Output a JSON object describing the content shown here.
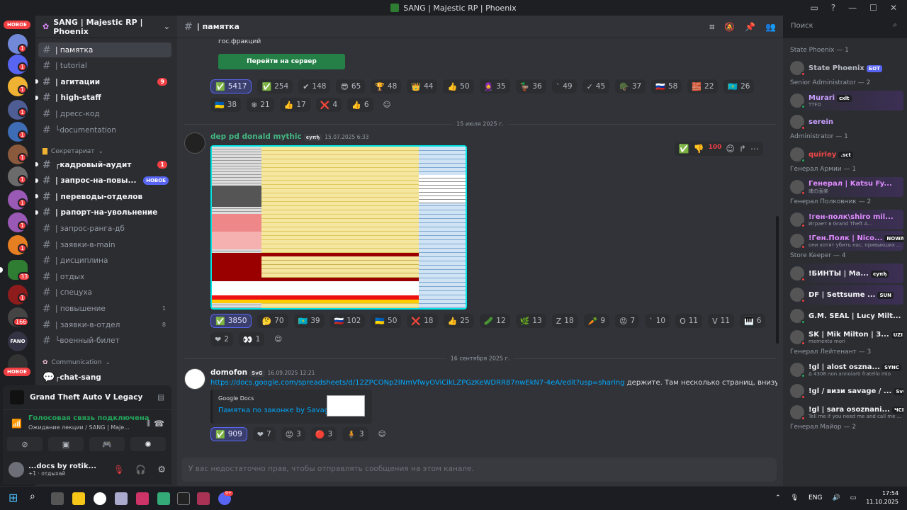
{
  "window": {
    "title": "SANG | Majestic RP | Phoenix",
    "controls": [
      "screen-share",
      "help",
      "minimize",
      "maximize",
      "close"
    ]
  },
  "guilds": {
    "new_label_top": "НОВОЕ",
    "new_label_bottom": "НОВОЕ",
    "badges": [
      "1",
      "1",
      "1",
      "1",
      "1",
      "1",
      "1",
      "1",
      "1",
      "1",
      "33",
      "1",
      "166"
    ],
    "fano_label": "FANO"
  },
  "server": {
    "name": "SANG | Majestic RP | Phoenix"
  },
  "channels": [
    {
      "name": "| памятка",
      "state": "active"
    },
    {
      "name": "| tutorial",
      "state": "muted"
    },
    {
      "name": "| агитации",
      "state": "unread",
      "count": "9"
    },
    {
      "name": "| high-staff",
      "state": "unread"
    },
    {
      "name": "| дресс-код",
      "state": "muted"
    },
    {
      "name": "└documentation",
      "state": "muted"
    }
  ],
  "category_secretariat": "Секретариат",
  "channels2": [
    {
      "name": "┌кадровый-аудит",
      "state": "unread",
      "count": "1"
    },
    {
      "name": "| запрос-на-повы...",
      "state": "unread",
      "new": "НОВОЕ"
    },
    {
      "name": "| переводы-отделов",
      "state": "unread"
    },
    {
      "name": "| рапорт-на-увольнение",
      "state": "unread"
    },
    {
      "name": "| запрос-ранга-дб",
      "state": "muted"
    },
    {
      "name": "| заявки-в-main",
      "state": "muted"
    },
    {
      "name": "| дисциплина",
      "state": "muted"
    },
    {
      "name": "| отдых",
      "state": "muted"
    },
    {
      "name": "| спецуха",
      "state": "muted"
    },
    {
      "name": "| повышение",
      "state": "muted",
      "count2": "1"
    },
    {
      "name": "| заявки-в-отдел",
      "state": "muted",
      "count2": "8"
    },
    {
      "name": "└военный-билет",
      "state": "muted"
    }
  ],
  "category_communication": "Communication",
  "channel_chat": "┌chat-sang",
  "activity": {
    "game": "Grand Theft Auto V Legacy"
  },
  "voice": {
    "status": "Голосовая связь подключена",
    "channel": "Ожидание лекции / SANG | Maje..."
  },
  "user": {
    "name": "...docs by rotik...",
    "status": "+1 · отдыхай"
  },
  "header": {
    "channel": "| памятка"
  },
  "search": {
    "placeholder": "Поиск"
  },
  "top_embed": {
    "text": "гос.фракций",
    "button": "Перейти на сервер"
  },
  "reactions1": [
    {
      "e": "✅",
      "n": "5417",
      "me": true
    },
    {
      "e": "✅",
      "n": "254"
    },
    {
      "e": "✔",
      "n": "148"
    },
    {
      "e": "😎",
      "n": "65"
    },
    {
      "e": "🏆",
      "n": "48"
    },
    {
      "e": "👑",
      "n": "44"
    },
    {
      "e": "👍",
      "n": "50"
    },
    {
      "e": "🧕",
      "n": "35"
    },
    {
      "e": "🦆",
      "n": "36"
    },
    {
      "e": "ˋ",
      "n": "49"
    },
    {
      "e": "✓",
      "n": "45"
    },
    {
      "e": "🪖",
      "n": "37"
    },
    {
      "e": "🇷🇺",
      "n": "58"
    },
    {
      "e": "🧱",
      "n": "22"
    },
    {
      "e": "🇰🇿",
      "n": "26"
    },
    {
      "e": "🇺🇦",
      "n": "38"
    },
    {
      "e": "❄",
      "n": "21"
    },
    {
      "e": "👍",
      "n": "17"
    },
    {
      "e": "❌",
      "n": "4"
    },
    {
      "e": "👍",
      "n": "6"
    }
  ],
  "date1": "15 июля 2025 г.",
  "msg1": {
    "author": "dep pd donald mythic",
    "tag": "ϵуπђ",
    "time": "15.07.2025 6:33"
  },
  "reactions2": [
    {
      "e": "✅",
      "n": "3850",
      "me": true
    },
    {
      "e": "🤔",
      "n": "70"
    },
    {
      "e": "🇰🇿",
      "n": "39"
    },
    {
      "e": "🇷🇺",
      "n": "102"
    },
    {
      "e": "🇺🇦",
      "n": "50"
    },
    {
      "e": "❌",
      "n": "18"
    },
    {
      "e": "👍",
      "n": "25"
    },
    {
      "e": "🥒",
      "n": "12"
    },
    {
      "e": "🌿",
      "n": "13"
    },
    {
      "e": "Z",
      "n": "18"
    },
    {
      "e": "🥕",
      "n": "9"
    },
    {
      "e": "😡",
      "n": "7"
    },
    {
      "e": "ˋ",
      "n": "10"
    },
    {
      "e": "O",
      "n": "11"
    },
    {
      "e": "V",
      "n": "11"
    },
    {
      "e": "🎹",
      "n": "6"
    },
    {
      "e": "❤",
      "n": "2"
    },
    {
      "e": "👀",
      "n": "1"
    }
  ],
  "date2": "16 сентября 2025 г.",
  "msg2": {
    "author": "domofon",
    "tag": "SvG",
    "time": "16.09.2025 12:21",
    "link": "https://docs.google.com/spreadsheets/d/12ZPCONp2INmVfwyOViCikLZPGzKeWDRR87nwEkN7-4eA/edit?usp=sharing",
    "text": " держите. Там несколько страниц, внизу листайте",
    "embed_provider": "Google Docs",
    "embed_title": "Памятка по законке by Savage"
  },
  "reactions3": [
    {
      "e": "✅",
      "n": "909",
      "me": true
    },
    {
      "e": "❤",
      "n": "7"
    },
    {
      "e": "😡",
      "n": "3"
    },
    {
      "e": "🔴",
      "n": "3"
    },
    {
      "e": "🧍",
      "n": "3"
    }
  ],
  "input": {
    "placeholder": "У вас недостаточно прав, чтобы отправлять сообщения на этом канале."
  },
  "members": [
    {
      "cat": "State Phoenix — 1"
    },
    {
      "name": "State Phoenix",
      "bot": "БОТ",
      "color": "#b5bac1"
    },
    {
      "cat": "Senior Administrator — 2"
    },
    {
      "name": "Murari",
      "tag": "cxlt",
      "sub": "TTFD",
      "color": "#c9a0ff"
    },
    {
      "name": "serein",
      "color": "#c9a0ff"
    },
    {
      "cat": "Administrator — 1"
    },
    {
      "name": "quirley",
      "tag": ".sct",
      "color": "#f04747"
    },
    {
      "cat": "Генерал Армии — 1"
    },
    {
      "name": "Генерал | Katsu Fy...",
      "sub": "魂の面楽",
      "color": "#e08cff"
    },
    {
      "cat": "Генерал Полковник — 2"
    },
    {
      "name": "!ген-полк\\shiro mil...",
      "sub": "Играет в Grand Theft A...",
      "color": "#e08cff"
    },
    {
      "name": "!Ген.Полк | Nico...",
      "tag": "NOWA",
      "sub": "они хотят убить нас, привыкших ...",
      "color": "#e08cff"
    },
    {
      "cat": "Store Keeper — 4"
    },
    {
      "name": "!БИНТЫ | Ma...",
      "tag": "ϵуπђ",
      "color": "#f2f3f5"
    },
    {
      "name": "DF | Settsume ...",
      "tag": "SUN",
      "color": "#f2f3f5"
    },
    {
      "name": "G.M. SEAL | Lucy Milt...",
      "color": "#f2f3f5"
    },
    {
      "name": "SK | Mik Milton | 3...",
      "tag": "UZI",
      "sub": "memento mori",
      "color": "#f2f3f5"
    },
    {
      "cat": "Генерал Лейтенант — 3"
    },
    {
      "name": "!gl | alost oszna...",
      "tag": "SYNC",
      "sub": "Δ 4308 non annoiarti fratello mio",
      "color": "#f2f3f5"
    },
    {
      "name": "!gl / визи savage / ...",
      "tag": "SvG",
      "color": "#f2f3f5"
    },
    {
      "name": "!gl | sara osoznani...",
      "tag": "ЧСВ",
      "sub": "Tell me if you need me and call me ...",
      "color": "#f2f3f5"
    },
    {
      "cat": "Генерал Майор — 2"
    }
  ],
  "taskbar": {
    "lang": "ENG",
    "time": "17:54",
    "date": "11.10.2025",
    "discord_badge": "9+"
  }
}
